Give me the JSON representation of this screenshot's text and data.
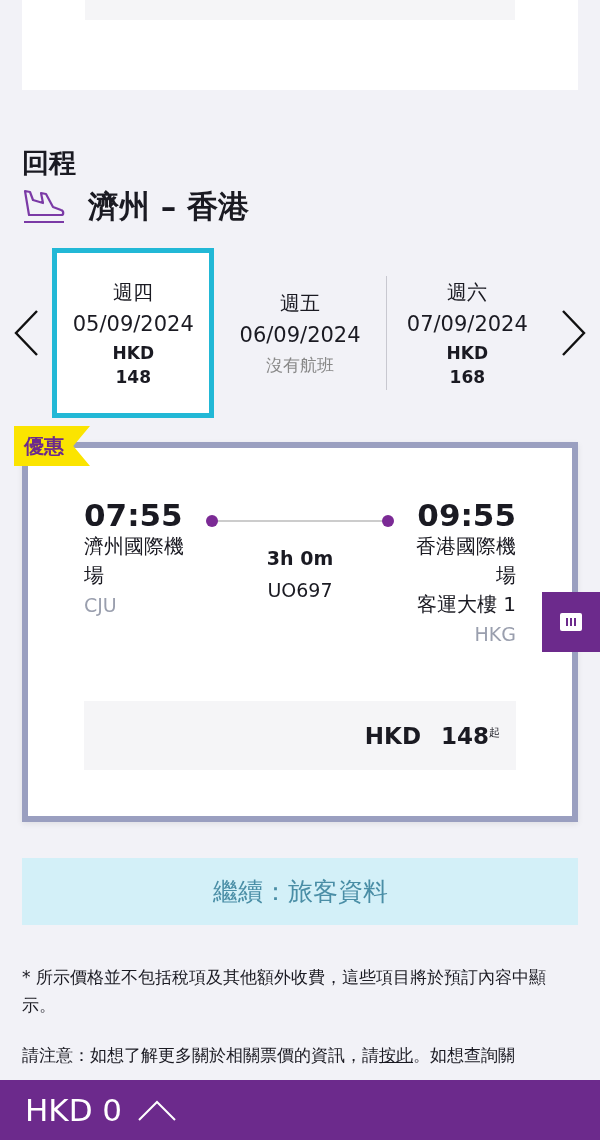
{
  "section_title": "回程",
  "route": "濟州 – 香港",
  "dates": [
    {
      "weekday": "週四",
      "date": "05/09/2024",
      "currency": "HKD",
      "price": "148",
      "selected": true
    },
    {
      "weekday": "週五",
      "date": "06/09/2024",
      "status": "沒有航班",
      "selected": false
    },
    {
      "weekday": "週六",
      "date": "07/09/2024",
      "currency": "HKD",
      "price": "168",
      "selected": false
    }
  ],
  "flight": {
    "badge": "優惠",
    "depart_time": "07:55",
    "depart_airport": "濟州國際機場",
    "depart_code": "CJU",
    "arrive_time": "09:55",
    "arrive_airport": "香港國際機場",
    "arrive_terminal": "客運大樓 1",
    "arrive_code": "HKG",
    "duration": "3h 0m",
    "flight_number": "UO697",
    "currency": "HKD",
    "price": "148",
    "price_suffix": "起"
  },
  "continue_button": {
    "label": "繼續：旅客資料",
    "disabled": true
  },
  "notes": [
    {
      "text": "* 所示價格並不包括稅項及其他額外收費，這些項目將於預訂內容中顯示。"
    },
    {
      "before": "請注意：如想了解更多關於相關票價的資訊，請",
      "link": "按此",
      "after": "。如想查詢關"
    }
  ],
  "bottom_bar": {
    "total": "HKD 0"
  }
}
